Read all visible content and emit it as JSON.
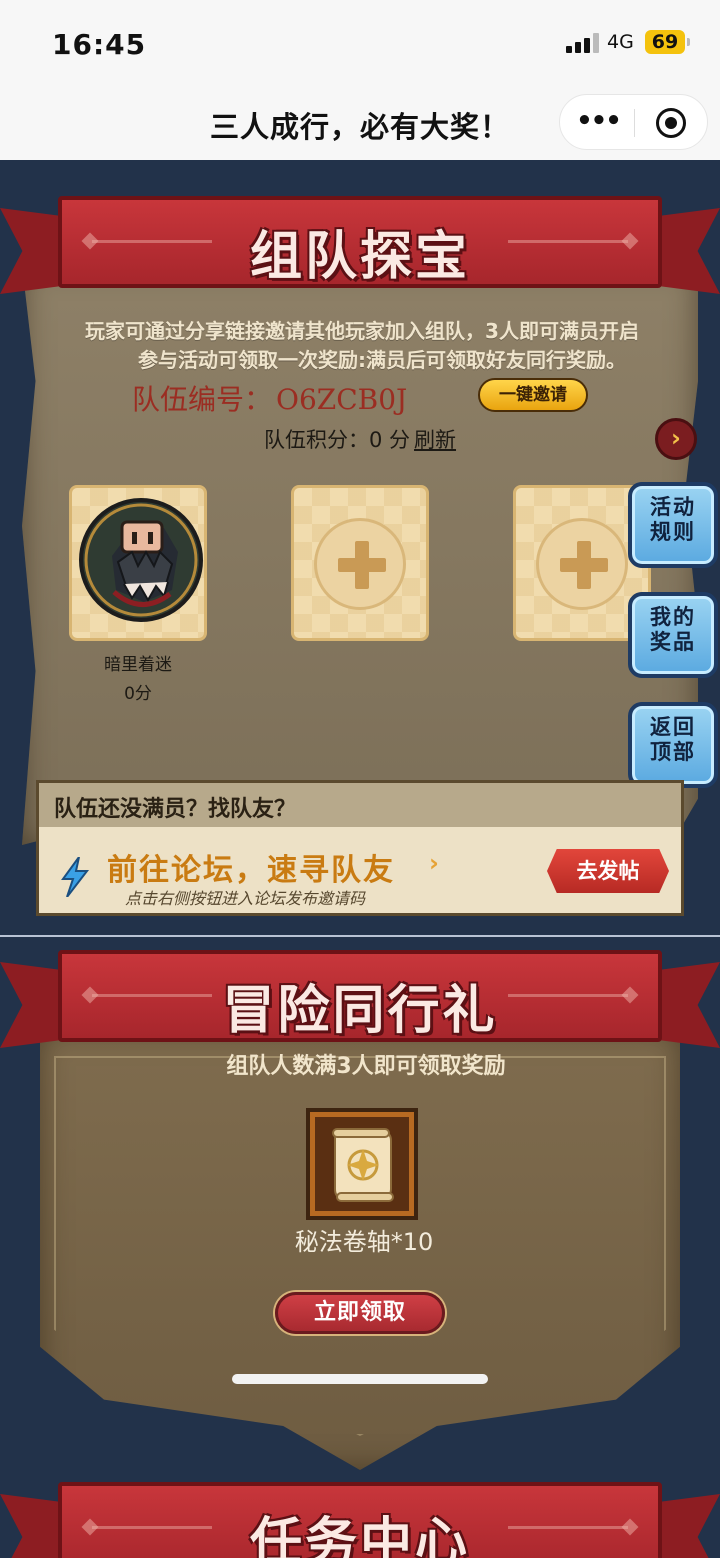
{
  "status_bar": {
    "time": "16:45",
    "network": "4G",
    "battery": "69"
  },
  "nav": {
    "title": "三人成行，必有大奖！",
    "more_icon": "more-dots-icon",
    "close_icon": "mini-program-close-icon"
  },
  "team_section": {
    "banner_title": "组队探宝",
    "intro_line1": "玩家可通过分享链接邀请其他玩家加入组队，3人即可满员开启",
    "intro_line2": "参与活动可领取一次奖励:满员后可领取好友同行奖励。",
    "team_id_label": "队伍编号：",
    "team_id_value": "O6ZCB0J",
    "invite_button": "一键邀请",
    "score_text": "队伍积分：0 分",
    "refresh_link": "刷新",
    "members": [
      {
        "name": "暗里着迷",
        "score": "0分",
        "filled": true
      },
      {
        "filled": false
      },
      {
        "filled": false
      }
    ]
  },
  "side_buttons": [
    {
      "label": "活动规则"
    },
    {
      "label": "我的奖品"
    },
    {
      "label": "返回顶部"
    }
  ],
  "forum_card": {
    "header": "队伍还没满员？找队友？",
    "title": "前往论坛，速寻队友",
    "subtitle": "点击右侧按钮进入论坛发布邀请码",
    "post_button": "去发帖"
  },
  "reward_section": {
    "banner_title": "冒险同行礼",
    "subtitle": "组队人数满3人即可领取奖励",
    "item_name": "秘法卷轴*10",
    "claim_button": "立即领取"
  },
  "next_section": {
    "banner_title": "任务中心"
  }
}
